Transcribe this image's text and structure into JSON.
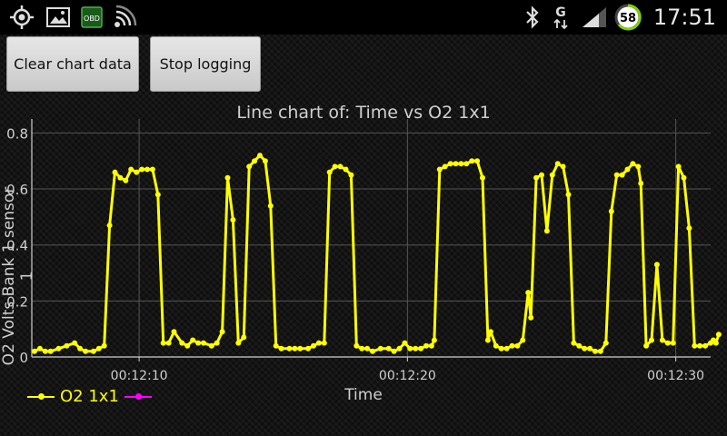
{
  "statusbar": {
    "icons": [
      "gps-icon",
      "gallery-icon",
      "obd-icon",
      "wifi-icon",
      "bluetooth-icon",
      "g-data-icon",
      "signal-icon",
      "battery-icon"
    ],
    "obd_label": "OBD",
    "g_label": "G",
    "battery_level": "58",
    "clock": "17:51"
  },
  "buttons": {
    "clear_label": "Clear chart data",
    "stop_label": "Stop logging"
  },
  "colors": {
    "series": "#ffff00",
    "series2": "#ff00ff",
    "axis": "#cfcfcf",
    "grid": "#555555",
    "battery_ring": "#7fd000"
  },
  "chart_data": {
    "type": "line",
    "title": "Line chart of: Time vs O2 1x1",
    "xlabel": "Time",
    "ylabel": "O2 Volts Bank 1 sensor 1",
    "ylim": [
      0,
      0.85
    ],
    "xlim": [
      6.0,
      31.3
    ],
    "x_ticks": [
      10,
      20,
      30
    ],
    "x_tick_labels": [
      "00:12:10",
      "00:12:20",
      "00:12:30"
    ],
    "y_ticks": [
      0,
      0.2,
      0.4,
      0.6,
      0.8
    ],
    "y_tick_labels": [
      "0",
      "0.2",
      "0.4",
      "0.6",
      "0.8"
    ],
    "grid": true,
    "legend": "bottom-left",
    "series": [
      {
        "name": "O2 1x1",
        "color": "#ffff00",
        "points": [
          [
            6.1,
            0.02
          ],
          [
            6.3,
            0.03
          ],
          [
            6.5,
            0.02
          ],
          [
            6.7,
            0.02
          ],
          [
            7.0,
            0.03
          ],
          [
            7.3,
            0.04
          ],
          [
            7.6,
            0.05
          ],
          [
            7.8,
            0.03
          ],
          [
            8.0,
            0.02
          ],
          [
            8.3,
            0.02
          ],
          [
            8.5,
            0.03
          ],
          [
            8.7,
            0.04
          ],
          [
            8.9,
            0.47
          ],
          [
            9.1,
            0.66
          ],
          [
            9.3,
            0.64
          ],
          [
            9.5,
            0.63
          ],
          [
            9.7,
            0.67
          ],
          [
            9.9,
            0.66
          ],
          [
            10.1,
            0.67
          ],
          [
            10.3,
            0.67
          ],
          [
            10.5,
            0.67
          ],
          [
            10.7,
            0.58
          ],
          [
            10.9,
            0.05
          ],
          [
            11.1,
            0.05
          ],
          [
            11.3,
            0.09
          ],
          [
            11.6,
            0.05
          ],
          [
            11.8,
            0.04
          ],
          [
            12.0,
            0.06
          ],
          [
            12.2,
            0.05
          ],
          [
            12.4,
            0.05
          ],
          [
            12.7,
            0.04
          ],
          [
            12.9,
            0.05
          ],
          [
            13.1,
            0.09
          ],
          [
            13.3,
            0.64
          ],
          [
            13.5,
            0.49
          ],
          [
            13.7,
            0.05
          ],
          [
            13.9,
            0.07
          ],
          [
            14.1,
            0.68
          ],
          [
            14.3,
            0.7
          ],
          [
            14.5,
            0.72
          ],
          [
            14.7,
            0.7
          ],
          [
            14.9,
            0.54
          ],
          [
            15.1,
            0.04
          ],
          [
            15.3,
            0.03
          ],
          [
            15.6,
            0.03
          ],
          [
            15.8,
            0.03
          ],
          [
            16.0,
            0.03
          ],
          [
            16.3,
            0.03
          ],
          [
            16.5,
            0.04
          ],
          [
            16.7,
            0.05
          ],
          [
            16.9,
            0.05
          ],
          [
            17.1,
            0.66
          ],
          [
            17.3,
            0.68
          ],
          [
            17.5,
            0.68
          ],
          [
            17.7,
            0.67
          ],
          [
            17.9,
            0.65
          ],
          [
            18.1,
            0.04
          ],
          [
            18.3,
            0.03
          ],
          [
            18.5,
            0.03
          ],
          [
            18.7,
            0.02
          ],
          [
            19.0,
            0.03
          ],
          [
            19.3,
            0.03
          ],
          [
            19.5,
            0.02
          ],
          [
            19.7,
            0.03
          ],
          [
            19.9,
            0.05
          ],
          [
            20.1,
            0.03
          ],
          [
            20.3,
            0.03
          ],
          [
            20.5,
            0.03
          ],
          [
            20.7,
            0.04
          ],
          [
            20.9,
            0.04
          ],
          [
            21.0,
            0.06
          ],
          [
            21.2,
            0.67
          ],
          [
            21.4,
            0.68
          ],
          [
            21.6,
            0.69
          ],
          [
            21.8,
            0.69
          ],
          [
            22.0,
            0.69
          ],
          [
            22.2,
            0.69
          ],
          [
            22.4,
            0.7
          ],
          [
            22.6,
            0.7
          ],
          [
            22.8,
            0.64
          ],
          [
            23.0,
            0.06
          ],
          [
            23.1,
            0.09
          ],
          [
            23.3,
            0.04
          ],
          [
            23.5,
            0.03
          ],
          [
            23.7,
            0.03
          ],
          [
            23.9,
            0.04
          ],
          [
            24.1,
            0.04
          ],
          [
            24.3,
            0.06
          ],
          [
            24.5,
            0.23
          ],
          [
            24.6,
            0.14
          ],
          [
            24.8,
            0.64
          ],
          [
            25.0,
            0.65
          ],
          [
            25.2,
            0.45
          ],
          [
            25.4,
            0.65
          ],
          [
            25.6,
            0.69
          ],
          [
            25.8,
            0.68
          ],
          [
            26.0,
            0.58
          ],
          [
            26.2,
            0.05
          ],
          [
            26.4,
            0.04
          ],
          [
            26.6,
            0.03
          ],
          [
            26.8,
            0.03
          ],
          [
            27.0,
            0.02
          ],
          [
            27.2,
            0.02
          ],
          [
            27.4,
            0.05
          ],
          [
            27.6,
            0.52
          ],
          [
            27.8,
            0.65
          ],
          [
            28.0,
            0.65
          ],
          [
            28.2,
            0.67
          ],
          [
            28.4,
            0.69
          ],
          [
            28.6,
            0.68
          ],
          [
            28.7,
            0.62
          ],
          [
            28.9,
            0.04
          ],
          [
            29.1,
            0.06
          ],
          [
            29.3,
            0.33
          ],
          [
            29.5,
            0.06
          ],
          [
            29.7,
            0.05
          ],
          [
            29.9,
            0.05
          ],
          [
            30.1,
            0.68
          ],
          [
            30.3,
            0.64
          ],
          [
            30.5,
            0.46
          ],
          [
            30.7,
            0.04
          ],
          [
            30.9,
            0.04
          ],
          [
            31.1,
            0.04
          ],
          [
            31.3,
            0.05
          ],
          [
            31.4,
            0.06
          ],
          [
            31.5,
            0.05
          ],
          [
            31.6,
            0.08
          ]
        ]
      },
      {
        "name": "",
        "color": "#ff00ff",
        "points": []
      }
    ]
  }
}
